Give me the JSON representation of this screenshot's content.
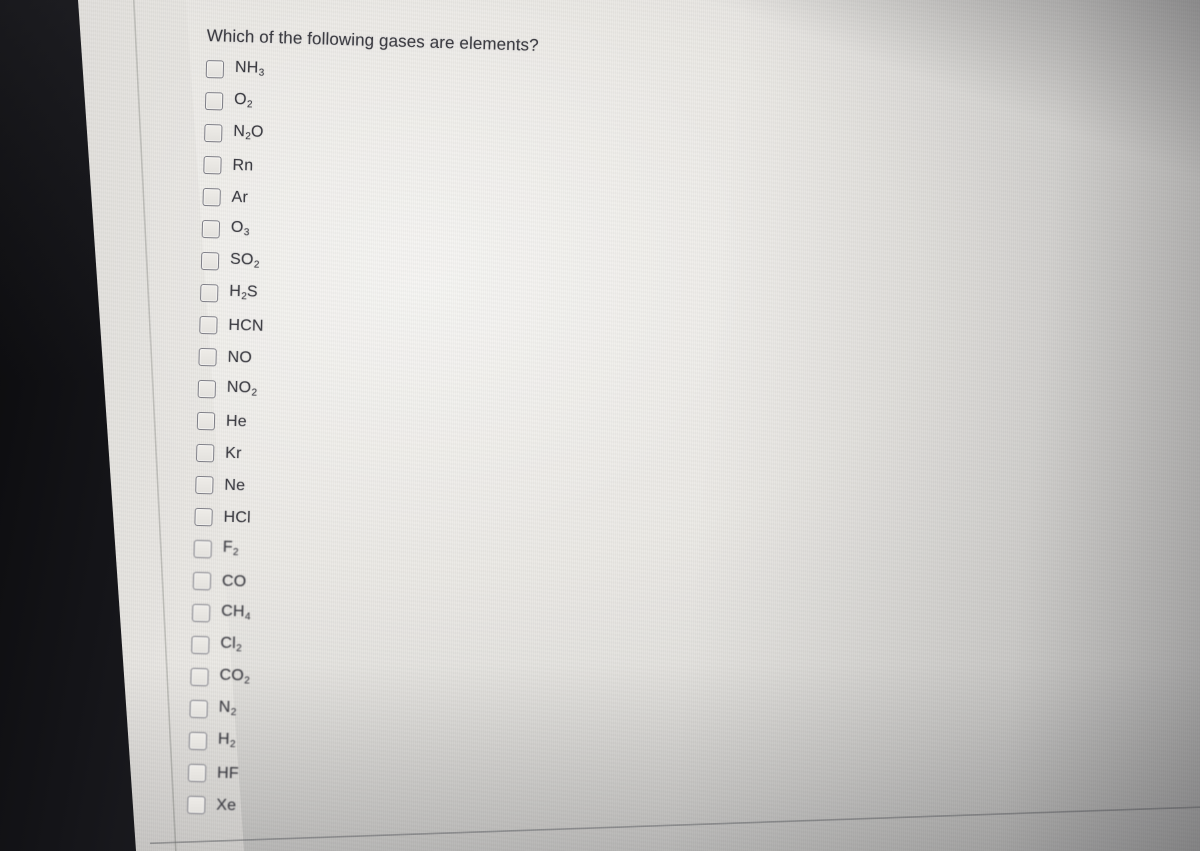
{
  "screen": {
    "device": "computer-monitor-photo",
    "bezel_color": "#121216",
    "panel_background": "#eceae6",
    "text_color": "#3c3c42",
    "checkbox_border_color": "#7e7e86"
  },
  "quiz": {
    "question": "Which of the following gases are elements?",
    "checkbox_state": "unchecked",
    "option_count": 24,
    "options": [
      {
        "formula": "NH3",
        "base": "NH",
        "sub": "3",
        "checked": false
      },
      {
        "formula": "O2",
        "base": "O",
        "sub": "2",
        "checked": false
      },
      {
        "formula": "N2O",
        "base": "N",
        "sub": "2",
        "tail": "O",
        "checked": false
      },
      {
        "formula": "Rn",
        "base": "Rn",
        "sub": "",
        "checked": false
      },
      {
        "formula": "Ar",
        "base": "Ar",
        "sub": "",
        "checked": false
      },
      {
        "formula": "O3",
        "base": "O",
        "sub": "3",
        "checked": false
      },
      {
        "formula": "SO2",
        "base": "SO",
        "sub": "2",
        "checked": false
      },
      {
        "formula": "H2S",
        "base": "H",
        "sub": "2",
        "tail": "S",
        "checked": false
      },
      {
        "formula": "HCN",
        "base": "HCN",
        "sub": "",
        "checked": false
      },
      {
        "formula": "NO",
        "base": "NO",
        "sub": "",
        "checked": false
      },
      {
        "formula": "NO2",
        "base": "NO",
        "sub": "2",
        "checked": false
      },
      {
        "formula": "He",
        "base": "He",
        "sub": "",
        "checked": false
      },
      {
        "formula": "Kr",
        "base": "Kr",
        "sub": "",
        "checked": false
      },
      {
        "formula": "Ne",
        "base": "Ne",
        "sub": "",
        "checked": false
      },
      {
        "formula": "HCl",
        "base": "HCl",
        "sub": "",
        "checked": false
      },
      {
        "formula": "F2",
        "base": "F",
        "sub": "2",
        "checked": false
      },
      {
        "formula": "CO",
        "base": "CO",
        "sub": "",
        "checked": false
      },
      {
        "formula": "CH4",
        "base": "CH",
        "sub": "4",
        "checked": false
      },
      {
        "formula": "Cl2",
        "base": "Cl",
        "sub": "2",
        "checked": false
      },
      {
        "formula": "CO2",
        "base": "CO",
        "sub": "2",
        "checked": false
      },
      {
        "formula": "N2",
        "base": "N",
        "sub": "2",
        "checked": false
      },
      {
        "formula": "H2",
        "base": "H",
        "sub": "2",
        "checked": false
      },
      {
        "formula": "HF",
        "base": "HF",
        "sub": "",
        "checked": false
      },
      {
        "formula": "Xe",
        "base": "Xe",
        "sub": "",
        "checked": false
      }
    ]
  }
}
